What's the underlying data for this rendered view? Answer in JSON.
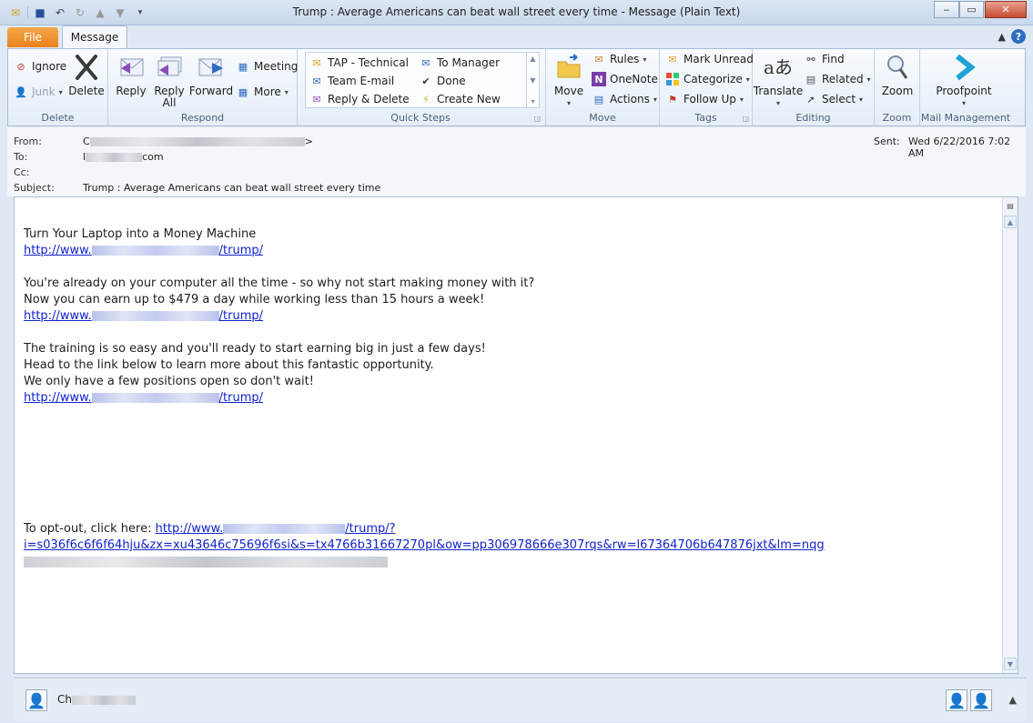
{
  "window": {
    "title": "Trump : Average Americans can beat wall street every time  -  Message (Plain Text)"
  },
  "tabs": {
    "file": "File",
    "message": "Message"
  },
  "ribbon": {
    "delete_group": {
      "label": "Delete",
      "ignore": "Ignore",
      "junk": "Junk",
      "delete": "Delete"
    },
    "respond_group": {
      "label": "Respond",
      "reply": "Reply",
      "reply_all_1": "Reply",
      "reply_all_2": "All",
      "forward": "Forward",
      "meeting": "Meeting",
      "more": "More"
    },
    "quicksteps_group": {
      "label": "Quick Steps",
      "tap": "TAP - Technical",
      "team": "Team E-mail",
      "reply_delete": "Reply & Delete",
      "to_manager": "To Manager",
      "done": "Done",
      "create_new": "Create New"
    },
    "move_group": {
      "label": "Move",
      "move": "Move",
      "rules": "Rules",
      "onenote": "OneNote",
      "actions": "Actions"
    },
    "tags_group": {
      "label": "Tags",
      "mark_unread": "Mark Unread",
      "categorize": "Categorize",
      "follow_up": "Follow Up"
    },
    "editing_group": {
      "label": "Editing",
      "translate": "Translate",
      "find": "Find",
      "related": "Related",
      "select": "Select"
    },
    "zoom_group": {
      "label": "Zoom",
      "zoom": "Zoom"
    },
    "mail_group": {
      "label": "Mail Management",
      "proofpoint": "Proofpoint"
    }
  },
  "header": {
    "from_label": "From:",
    "from_prefix": "C",
    "from_suffix": ">",
    "to_label": "To:",
    "to_prefix": "l",
    "to_suffix": "com",
    "cc_label": "Cc:",
    "subject_label": "Subject:",
    "subject": "Trump : Average Americans can beat wall street every time",
    "sent_label": "Sent:",
    "sent_value": "Wed 6/22/2016 7:02 AM"
  },
  "body": {
    "line1": "Turn Your Laptop into a Money Machine",
    "link_prefix": "http://www.",
    "link_suffix": "/trump/",
    "line2": "You're already on your computer all the time - so why not start making money with it?",
    "line3": "Now you can earn up to $479 a day while working less than 15 hours a week!",
    "line4": "The training is so easy and you'll ready to start earning big in just a few days!",
    "line5": "Head to the link below to learn more about this fantastic opportunity.",
    "line6": "We only have a few positions open so don't wait!",
    "optout_text": "To opt-out, click here: ",
    "optout_link_prefix": "http://www.",
    "optout_link_suffix": "/trump/?",
    "optout_link_line2": "i=s036f6c6f6f64hju&zx=xu43646c75696f6si&s=tx4766b31667270pl&ow=pp306978666e307rqs&rw=l67364706b647876jxt&lm=nqg"
  },
  "footer": {
    "name_prefix": "Ch"
  }
}
